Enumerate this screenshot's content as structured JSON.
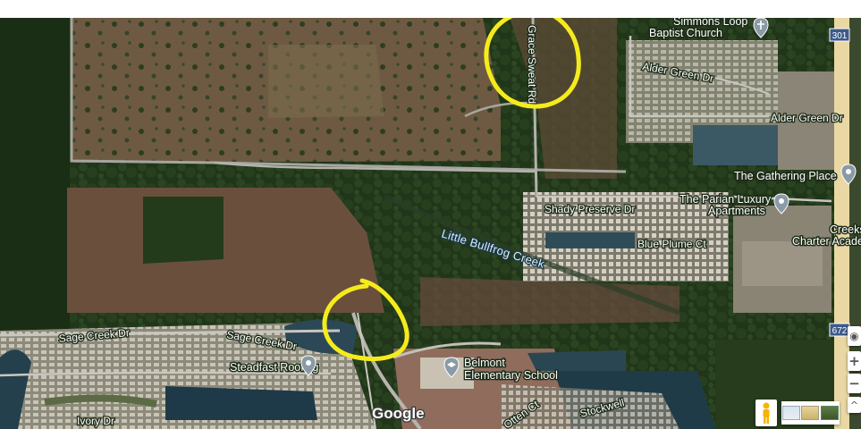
{
  "map": {
    "roads": {
      "grace_sweat_rd": "Grace Sweat Rd",
      "alder_green_dr_1": "Alder Green Dr",
      "alder_green_dr_2": "Alder Green Dr",
      "shady_preserve_dr": "Shady Preserve Dr",
      "blue_plume_ct": "Blue Plume Ct",
      "sage_creek_dr_1": "Sage Creek Dr",
      "sage_creek_dr_2": "Sage Creek Dr",
      "ivory_dr": "Ivory Dr",
      "stockwell": "Stockwell",
      "otten_ct": "Otten Ct",
      "route_301": "301",
      "route_672": "672"
    },
    "water": {
      "little_bullfrog_creek": "Little Bullfrog Creek"
    },
    "places": {
      "church_line1": "Simmons Loop",
      "church_line2": "Baptist Church",
      "gathering_place": "The Gathering Place",
      "parian_line1": "The Parian Luxury",
      "parian_line2": "Apartments",
      "creeks_line1": "Creeks",
      "creeks_line2": "Charter Acade",
      "steadfast_roofing": "Steadfast Roofing",
      "belmont_line1": "Belmont",
      "belmont_line2": "Elementary School"
    },
    "attribution": "Google",
    "annotation_color": "#f5eb1c"
  },
  "controls": {
    "pegman_icon": "pegman-icon",
    "zoom_in": "+",
    "zoom_out": "−",
    "expand": "^"
  }
}
